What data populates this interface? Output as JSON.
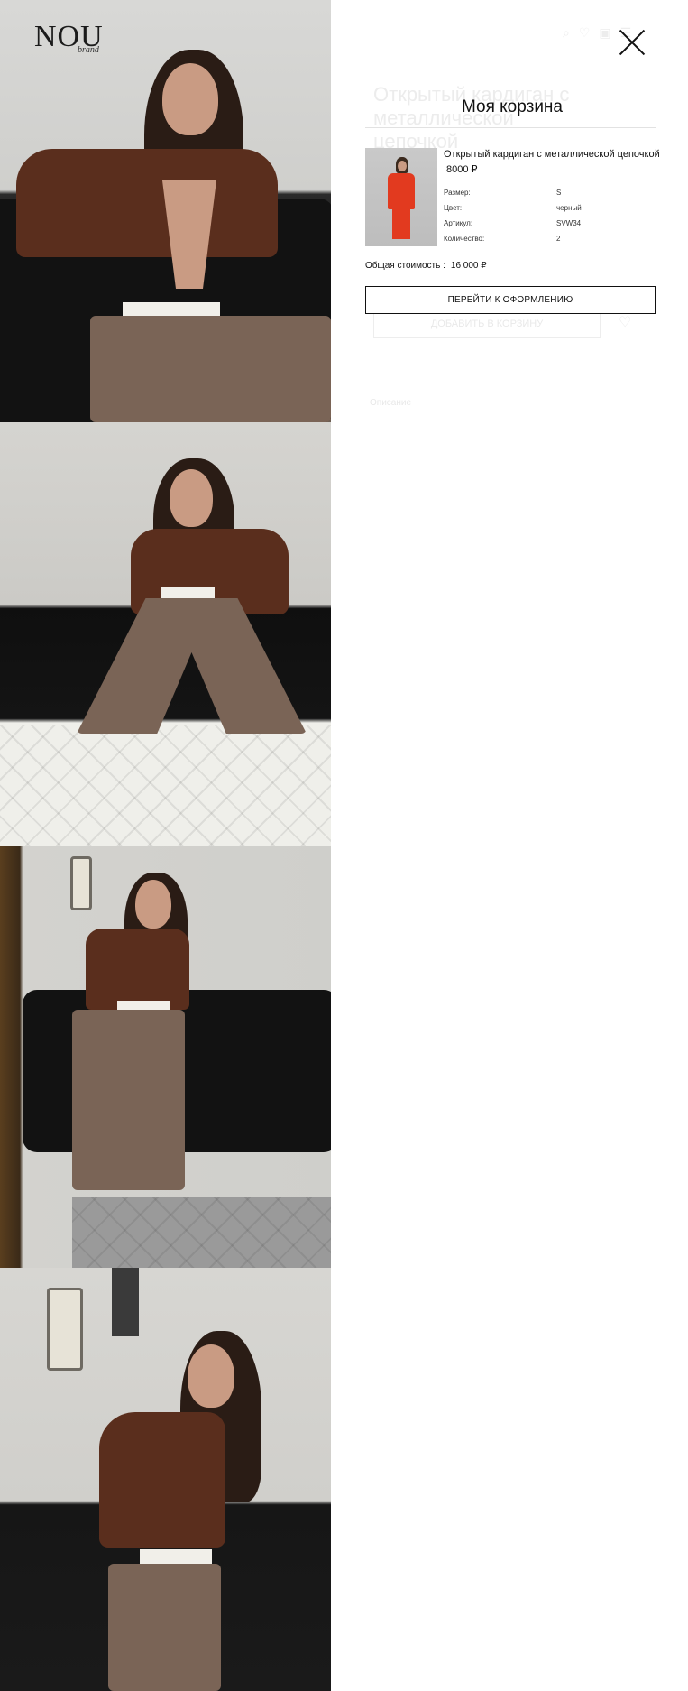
{
  "brand": {
    "logo": "NOU",
    "logo_sub": "brand"
  },
  "background_page": {
    "product_title": "Открытый кардиган с металлической цепочкой",
    "add_to_cart": "ДОБАВИТЬ В КОРЗИНУ",
    "description_tab": "Описание"
  },
  "cart": {
    "title": "Моя корзина",
    "item": {
      "name": "Открытый кардиган с металлической цепочкой",
      "price": "8000 ₽",
      "attributes": [
        {
          "label": "Размер:",
          "value": "S"
        },
        {
          "label": "Цвет:",
          "value": "черный"
        },
        {
          "label": "Артикул:",
          "value": "SVW34"
        },
        {
          "label": "Количество:",
          "value": "2"
        }
      ]
    },
    "total_label": "Общая стоимость :",
    "total_value": "16 000 ₽",
    "checkout_label": "ПЕРЕЙТИ К ОФОРМЛЕНИЮ"
  },
  "icons": [
    "close-icon",
    "search-icon",
    "heart-icon",
    "bag-icon",
    "menu-icon"
  ],
  "colors": {
    "accent": "#111111",
    "divider": "#e2e2e2"
  }
}
